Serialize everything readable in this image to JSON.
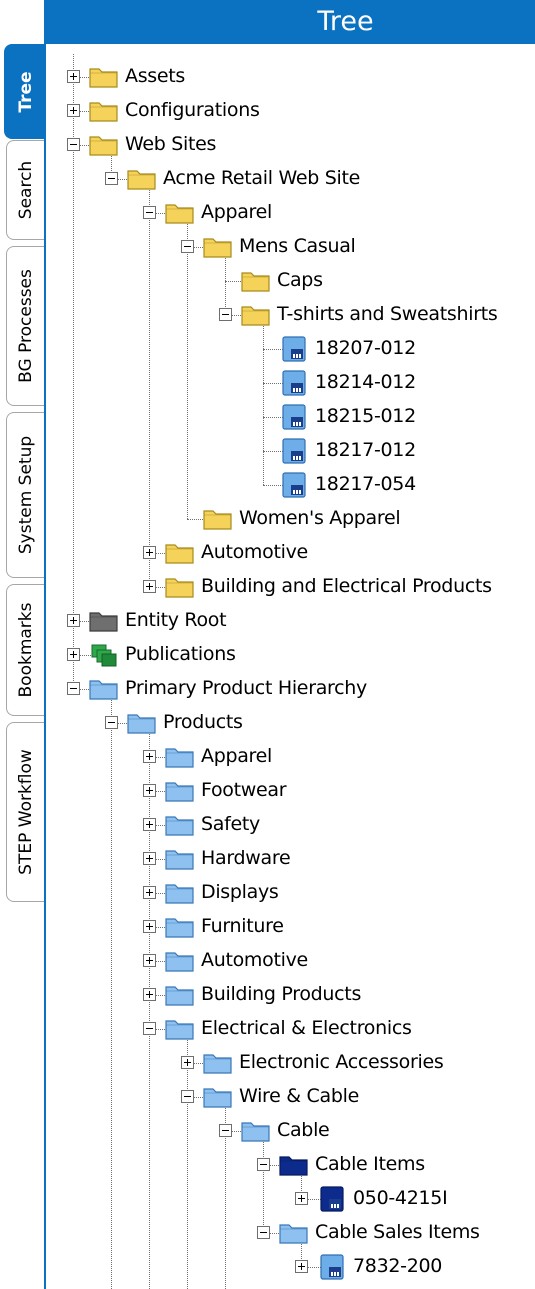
{
  "header": {
    "title": "Tree"
  },
  "tabs": [
    {
      "label": "Tree",
      "active": true
    },
    {
      "label": "Search",
      "active": false
    },
    {
      "label": "BG Processes",
      "active": false
    },
    {
      "label": "System Setup",
      "active": false
    },
    {
      "label": "Bookmarks",
      "active": false
    },
    {
      "label": "STEP Workflow",
      "active": false
    }
  ],
  "tree": {
    "nodes": [
      {
        "label": "Assets",
        "level": 0,
        "toggle": "plus",
        "icon": "folder-yellow"
      },
      {
        "label": "Configurations",
        "level": 0,
        "toggle": "plus",
        "icon": "folder-yellow"
      },
      {
        "label": "Web Sites",
        "level": 0,
        "toggle": "minus",
        "icon": "folder-yellow"
      },
      {
        "label": "Acme Retail Web Site",
        "level": 1,
        "toggle": "minus",
        "icon": "folder-yellow"
      },
      {
        "label": "Apparel",
        "level": 2,
        "toggle": "minus",
        "icon": "folder-yellow"
      },
      {
        "label": "Mens Casual",
        "level": 3,
        "toggle": "minus",
        "icon": "folder-yellow"
      },
      {
        "label": "Caps",
        "level": 4,
        "toggle": "none",
        "icon": "folder-yellow"
      },
      {
        "label": "T-shirts and Sweatshirts",
        "level": 4,
        "toggle": "minus",
        "icon": "folder-yellow"
      },
      {
        "label": "18207-012",
        "level": 5,
        "toggle": "none",
        "icon": "product-blue"
      },
      {
        "label": "18214-012",
        "level": 5,
        "toggle": "none",
        "icon": "product-blue"
      },
      {
        "label": "18215-012",
        "level": 5,
        "toggle": "none",
        "icon": "product-blue"
      },
      {
        "label": "18217-012",
        "level": 5,
        "toggle": "none",
        "icon": "product-blue"
      },
      {
        "label": "18217-054",
        "level": 5,
        "toggle": "none",
        "icon": "product-blue"
      },
      {
        "label": "Women's Apparel",
        "level": 3,
        "toggle": "none",
        "icon": "folder-yellow"
      },
      {
        "label": "Automotive",
        "level": 2,
        "toggle": "plus",
        "icon": "folder-yellow"
      },
      {
        "label": "Building and Electrical Products",
        "level": 2,
        "toggle": "plus",
        "icon": "folder-yellow"
      },
      {
        "label": "Entity Root",
        "level": 0,
        "toggle": "plus",
        "icon": "folder-gray"
      },
      {
        "label": "Publications",
        "level": 0,
        "toggle": "plus",
        "icon": "publications-green"
      },
      {
        "label": "Primary Product Hierarchy",
        "level": 0,
        "toggle": "minus",
        "icon": "folder-blue"
      },
      {
        "label": "Products",
        "level": 1,
        "toggle": "minus",
        "icon": "folder-blue"
      },
      {
        "label": "Apparel",
        "level": 2,
        "toggle": "plus",
        "icon": "folder-blue"
      },
      {
        "label": "Footwear",
        "level": 2,
        "toggle": "plus",
        "icon": "folder-blue"
      },
      {
        "label": "Safety",
        "level": 2,
        "toggle": "plus",
        "icon": "folder-blue"
      },
      {
        "label": "Hardware",
        "level": 2,
        "toggle": "plus",
        "icon": "folder-blue"
      },
      {
        "label": "Displays",
        "level": 2,
        "toggle": "plus",
        "icon": "folder-blue"
      },
      {
        "label": "Furniture",
        "level": 2,
        "toggle": "plus",
        "icon": "folder-blue"
      },
      {
        "label": "Automotive",
        "level": 2,
        "toggle": "plus",
        "icon": "folder-blue"
      },
      {
        "label": "Building Products",
        "level": 2,
        "toggle": "plus",
        "icon": "folder-blue"
      },
      {
        "label": "Electrical & Electronics",
        "level": 2,
        "toggle": "minus",
        "icon": "folder-blue"
      },
      {
        "label": "Electronic Accessories",
        "level": 3,
        "toggle": "plus",
        "icon": "folder-blue"
      },
      {
        "label": "Wire & Cable",
        "level": 3,
        "toggle": "minus",
        "icon": "folder-blue"
      },
      {
        "label": "Cable",
        "level": 4,
        "toggle": "minus",
        "icon": "folder-blue"
      },
      {
        "label": "Cable Items",
        "level": 5,
        "toggle": "minus",
        "icon": "folder-darkblue"
      },
      {
        "label": "050-4215I",
        "level": 6,
        "toggle": "plus",
        "icon": "product-darkblue"
      },
      {
        "label": "Cable Sales Items",
        "level": 5,
        "toggle": "minus",
        "icon": "folder-blue"
      },
      {
        "label": "7832-200",
        "level": 6,
        "toggle": "plus",
        "icon": "product-blue"
      }
    ]
  },
  "colors": {
    "accent": "#0b72c2",
    "folder_yellow": "#f5d35a",
    "folder_blue": "#8ec1ef",
    "folder_darkblue": "#0d2b8c",
    "folder_gray": "#6f6f6f",
    "publications_green": "#2fa84a"
  }
}
